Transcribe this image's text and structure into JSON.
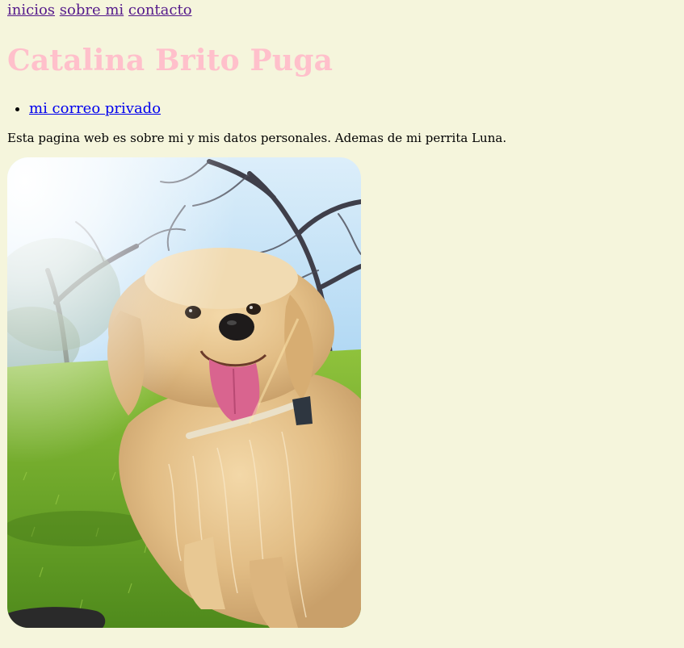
{
  "nav": {
    "items": [
      {
        "label": "inicios"
      },
      {
        "label": "sobre mi"
      },
      {
        "label": "contacto"
      }
    ]
  },
  "header": {
    "title": "Catalina Brito Puga"
  },
  "links": {
    "items": [
      {
        "label": "mi correo privado"
      }
    ]
  },
  "intro": {
    "text": "Esta pagina web es sobre mi y mis datos personales. Ademas de mi perrita Luna."
  },
  "colors": {
    "background": "#f5f5dc",
    "title": "#ffc0cb",
    "visited_link": "#551a8b",
    "link": "#0000ee"
  },
  "photo": {
    "icon": "dog-photo"
  }
}
